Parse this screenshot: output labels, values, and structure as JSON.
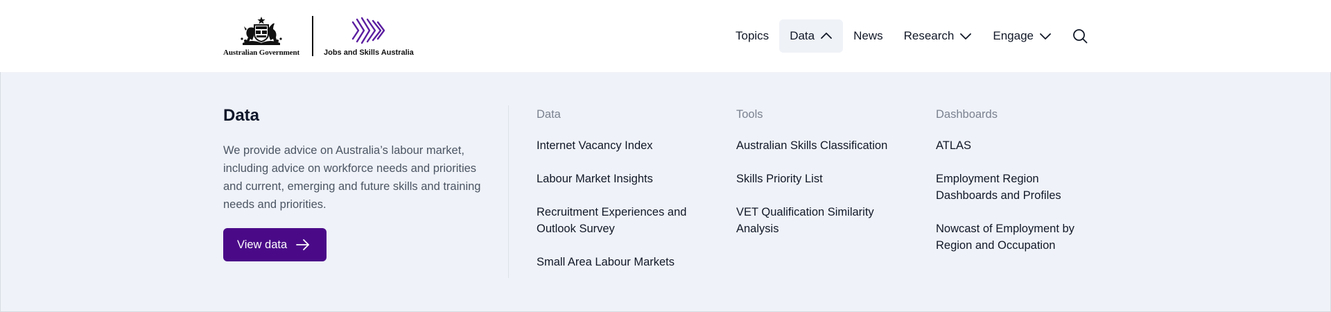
{
  "header": {
    "gov_label": "Australian Government",
    "org_label": "Jobs and Skills Australia",
    "brand_color": "#4a0a88"
  },
  "nav": {
    "items": [
      {
        "label": "Topics",
        "has_chevron": false,
        "active": false
      },
      {
        "label": "Data",
        "has_chevron": true,
        "chevron": "chevron-up-icon",
        "active": true
      },
      {
        "label": "News",
        "has_chevron": false,
        "active": false
      },
      {
        "label": "Research",
        "has_chevron": true,
        "chevron": "chevron-down-icon",
        "active": false
      },
      {
        "label": "Engage",
        "has_chevron": true,
        "chevron": "chevron-down-icon",
        "active": false
      }
    ],
    "search_icon": "search-icon"
  },
  "mega": {
    "title": "Data",
    "description": "We provide advice on Australia’s labour market, including advice on workforce needs and priorities and current, emerging and future skills and training needs and priorities.",
    "cta_label": "View data",
    "columns": [
      {
        "heading": "Data",
        "links": [
          "Internet Vacancy Index",
          "Labour Market Insights",
          "Recruitment Experiences and Outlook Survey",
          "Small Area Labour Markets"
        ]
      },
      {
        "heading": "Tools",
        "links": [
          "Australian Skills Classification",
          "Skills Priority List",
          "VET Qualification Similarity Analysis"
        ]
      },
      {
        "heading": "Dashboards",
        "links": [
          "ATLAS",
          "Employment Region Dashboards and Profiles",
          "Nowcast of Employment by Region and Occupation"
        ]
      }
    ]
  }
}
